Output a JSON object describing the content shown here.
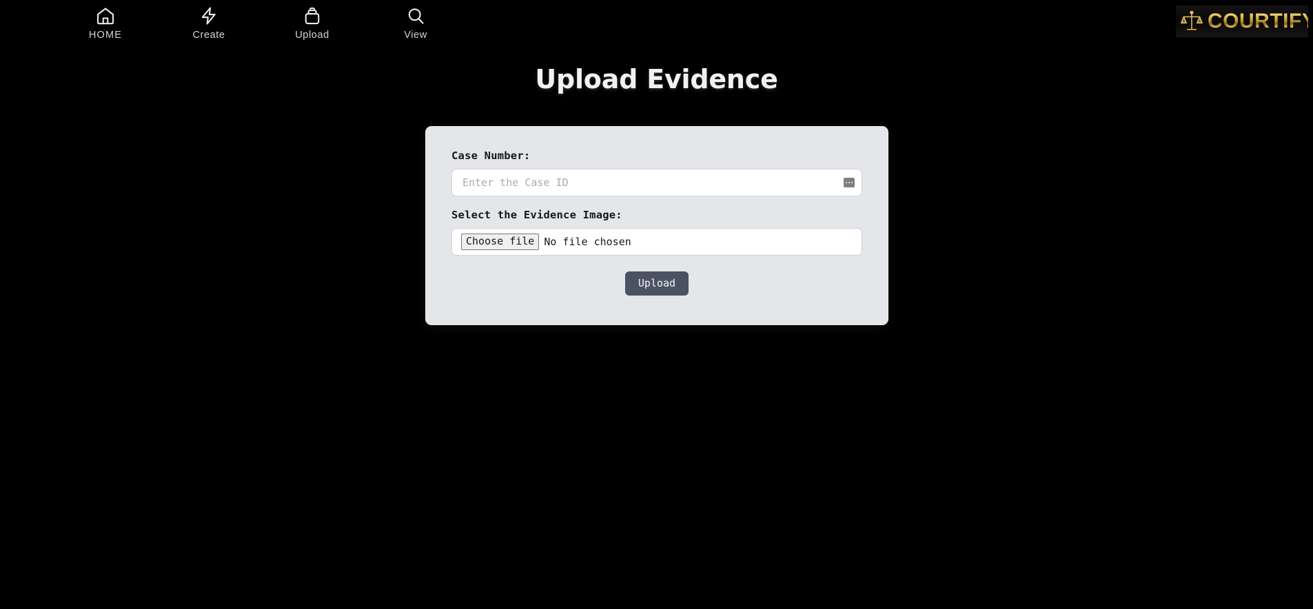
{
  "nav": {
    "items": [
      {
        "label": "HOME",
        "icon": "home-icon"
      },
      {
        "label": "Create",
        "icon": "zap-icon"
      },
      {
        "label": "Upload",
        "icon": "archive-box-icon"
      },
      {
        "label": "View",
        "icon": "search-icon"
      }
    ]
  },
  "brand": {
    "name": "COURTIFY",
    "logo_icon": "scales-of-justice-icon",
    "gold_light": "#f3e09a",
    "gold_mid": "#c39a33",
    "gold_dark": "#8c6a1d"
  },
  "page": {
    "title": "Upload Evidence",
    "background": "#000000"
  },
  "form": {
    "card_background": "#e4e6e9",
    "case_number": {
      "label": "Case Number:",
      "placeholder": "Enter the Case ID",
      "value": "",
      "autofill_icon": "autofill-dots-icon"
    },
    "evidence_image": {
      "label": "Select the Evidence Image:",
      "choose_button": "Choose file",
      "status": "No file chosen"
    },
    "submit": {
      "label": "Upload",
      "color": "#4b5262"
    }
  }
}
